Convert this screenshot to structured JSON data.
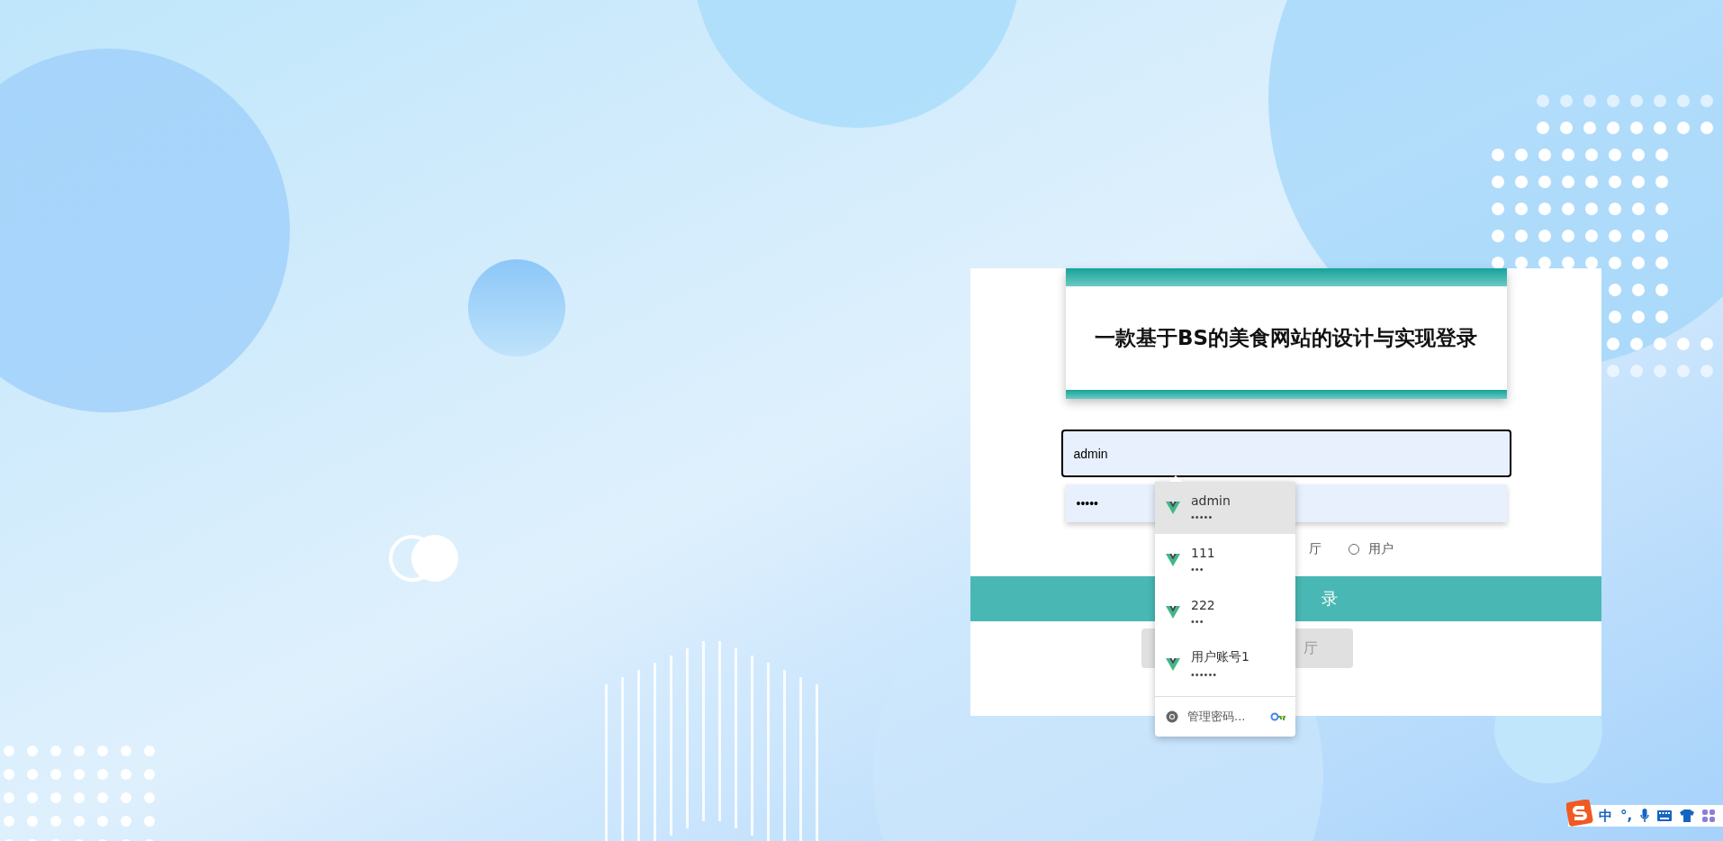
{
  "login_card": {
    "title": "一款基于BS的美食网站的设计与实现登录",
    "username": {
      "value": "admin",
      "focused": true
    },
    "password": {
      "value": "•••••"
    },
    "role_label_partial": "厅",
    "role_radio": {
      "label": "用户",
      "selected": false
    },
    "login_button": "录",
    "secondary_button": "厅"
  },
  "autofill": {
    "items": [
      {
        "username": "admin",
        "password": "•••••",
        "selected": true
      },
      {
        "username": "111",
        "password": "•••",
        "selected": false
      },
      {
        "username": "222",
        "password": "•••",
        "selected": false
      },
      {
        "username": "用户账号1",
        "password": "••••••",
        "selected": false
      }
    ],
    "manage": "管理密码..."
  },
  "ime_bar": {
    "mode": "中",
    "punct": "°,"
  }
}
